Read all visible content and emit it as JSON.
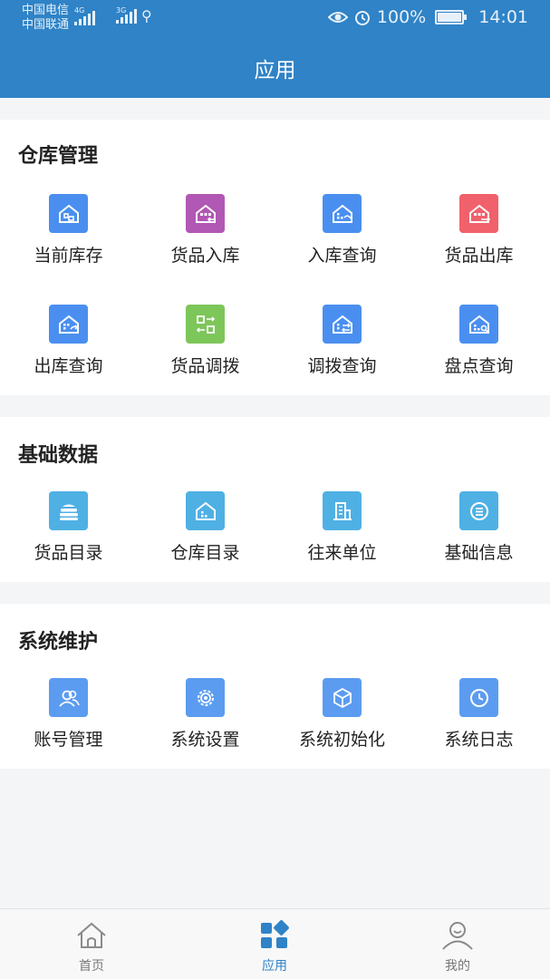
{
  "status_bar": {
    "carrier1": "中国电信",
    "carrier2": "中国联通",
    "net1": "4G",
    "net2": "3G",
    "battery": "100%",
    "time": "14:01"
  },
  "header": {
    "title": "应用"
  },
  "sections": [
    {
      "title": "仓库管理",
      "items": [
        {
          "label": "当前库存",
          "icon": "warehouse-stock-icon",
          "color": "#4a8ff0"
        },
        {
          "label": "货品入库",
          "icon": "goods-inbound-icon",
          "color": "#b157b4"
        },
        {
          "label": "入库查询",
          "icon": "inbound-query-icon",
          "color": "#4a8ff0"
        },
        {
          "label": "货品出库",
          "icon": "goods-outbound-icon",
          "color": "#f0616b"
        },
        {
          "label": "出库查询",
          "icon": "outbound-query-icon",
          "color": "#4a8ff0"
        },
        {
          "label": "货品调拨",
          "icon": "goods-transfer-icon",
          "color": "#7dc65a"
        },
        {
          "label": "调拨查询",
          "icon": "transfer-query-icon",
          "color": "#4a8ff0"
        },
        {
          "label": "盘点查询",
          "icon": "inventory-check-icon",
          "color": "#4a8ff0"
        }
      ]
    },
    {
      "title": "基础数据",
      "items": [
        {
          "label": "货品目录",
          "icon": "goods-catalog-icon",
          "color": "#4fb0e4"
        },
        {
          "label": "仓库目录",
          "icon": "warehouse-catalog-icon",
          "color": "#4fb0e4"
        },
        {
          "label": "往来单位",
          "icon": "partner-units-icon",
          "color": "#4fb0e4"
        },
        {
          "label": "基础信息",
          "icon": "basic-info-icon",
          "color": "#4fb0e4"
        }
      ]
    },
    {
      "title": "系统维护",
      "items": [
        {
          "label": "账号管理",
          "icon": "account-manage-icon",
          "color": "#5b9cf0"
        },
        {
          "label": "系统设置",
          "icon": "settings-gear-icon",
          "color": "#5b9cf0"
        },
        {
          "label": "系统初始化",
          "icon": "system-init-cube-icon",
          "color": "#5b9cf0"
        },
        {
          "label": "系统日志",
          "icon": "system-log-clock-icon",
          "color": "#5b9cf0"
        }
      ]
    }
  ],
  "bottom_nav": [
    {
      "label": "首页",
      "icon": "home-icon",
      "active": false
    },
    {
      "label": "应用",
      "icon": "apps-grid-icon",
      "active": true
    },
    {
      "label": "我的",
      "icon": "profile-icon",
      "active": false
    }
  ],
  "colors": {
    "primary": "#2f83c6",
    "background": "#f4f5f7",
    "inactive": "#777777"
  }
}
